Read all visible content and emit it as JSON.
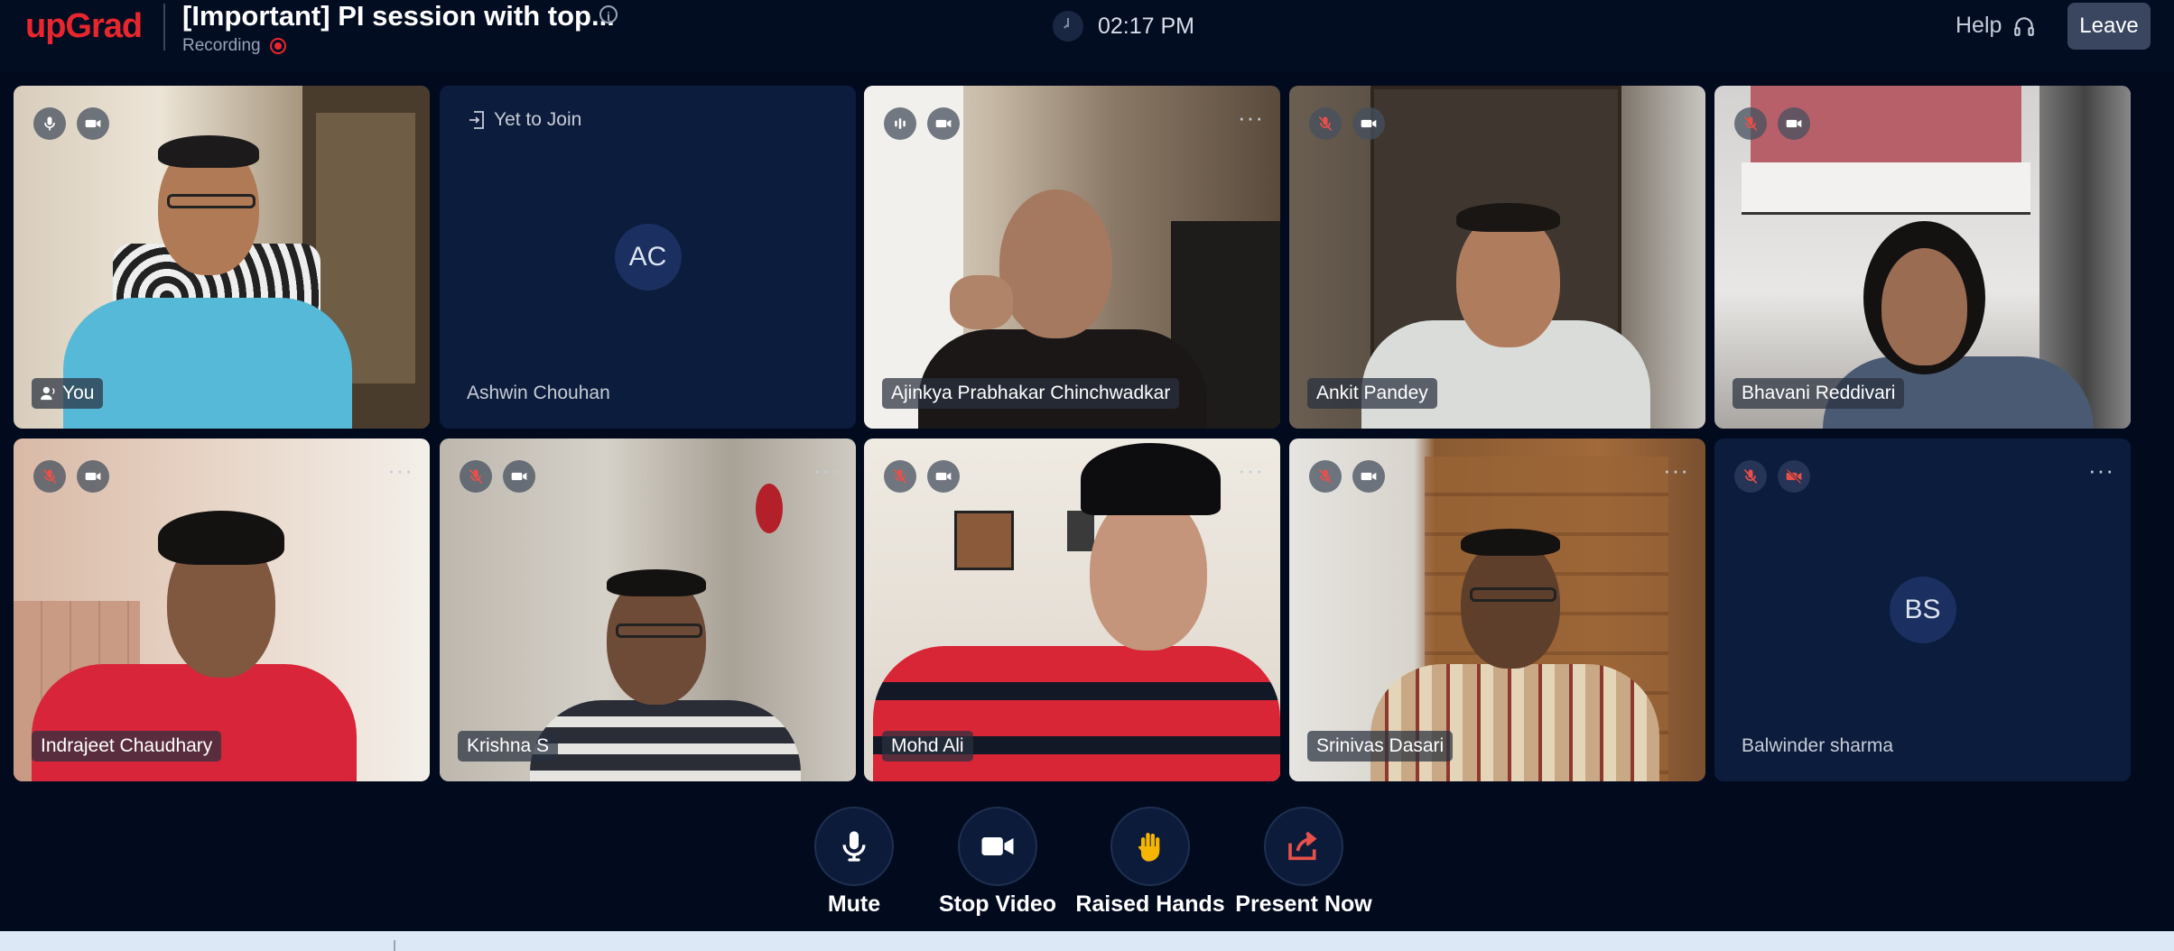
{
  "header": {
    "logo_text": "upGrad",
    "session_title": "[Important] PI session with top...",
    "info_icon": "i",
    "recording_label": "Recording",
    "time": "02:17 PM",
    "help_label": "Help",
    "leave_label": "Leave"
  },
  "participants": [
    {
      "name": "You",
      "status_text": "",
      "initials": "",
      "mic": "on",
      "camera": "on",
      "video": true
    },
    {
      "name": "Ashwin Chouhan",
      "status_text": "Yet to Join",
      "initials": "AC",
      "mic": "",
      "camera": "",
      "video": false
    },
    {
      "name": "Ajinkya Prabhakar Chinchwadkar",
      "status_text": "",
      "initials": "",
      "mic": "speaking",
      "camera": "on",
      "video": true
    },
    {
      "name": "Ankit Pandey",
      "status_text": "",
      "initials": "",
      "mic": "muted",
      "camera": "on",
      "video": true
    },
    {
      "name": "Bhavani Reddivari",
      "status_text": "",
      "initials": "",
      "mic": "muted",
      "camera": "on",
      "video": true
    },
    {
      "name": "Indrajeet Chaudhary",
      "status_text": "",
      "initials": "",
      "mic": "muted",
      "camera": "on",
      "video": true
    },
    {
      "name": "Krishna S",
      "status_text": "",
      "initials": "",
      "mic": "muted",
      "camera": "on",
      "video": true
    },
    {
      "name": "Mohd Ali",
      "status_text": "",
      "initials": "",
      "mic": "muted",
      "camera": "on",
      "video": true
    },
    {
      "name": "Srinivas Dasari",
      "status_text": "",
      "initials": "",
      "mic": "muted",
      "camera": "on",
      "video": true
    },
    {
      "name": "Balwinder sharma",
      "status_text": "",
      "initials": "BS",
      "mic": "muted",
      "camera": "off",
      "video": false
    }
  ],
  "controls": {
    "mute_label": "Mute",
    "stop_video_label": "Stop Video",
    "raised_hands_label": "Raised Hands",
    "present_now_label": "Present Now"
  },
  "colors": {
    "brand_red": "#e8262d",
    "background": "#020b1e",
    "tile_empty": "#0b1c3d",
    "leave_button": "#3a4660",
    "raise_hand": "#f4b400",
    "present_icon": "#e8504a"
  },
  "icons": {
    "mic": "microphone-icon",
    "mic_muted": "microphone-muted-icon",
    "camera": "video-camera-icon",
    "camera_off": "video-camera-off-icon",
    "speaking": "audio-level-icon",
    "more": "more-options-icon",
    "join": "enter-icon",
    "help": "headset-icon",
    "clock": "clock-icon",
    "hand": "raised-hand-icon",
    "share": "share-screen-icon"
  }
}
